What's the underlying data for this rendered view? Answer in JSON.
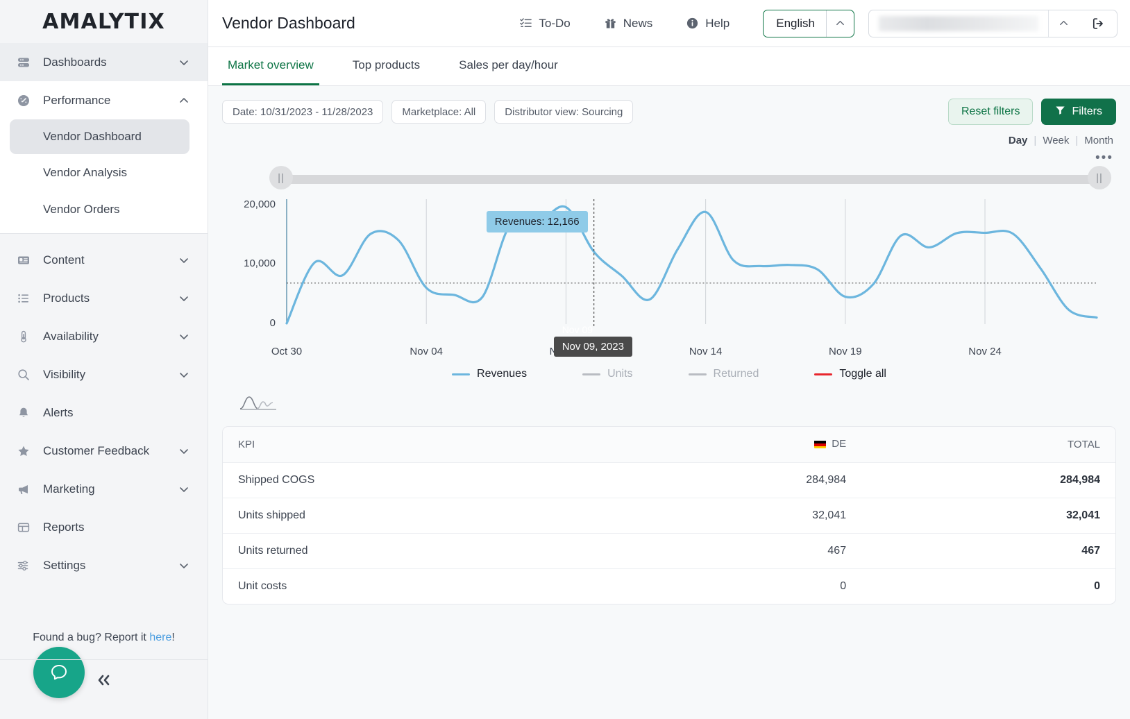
{
  "brand": {
    "logo": "AMALYTIX",
    "accent": "#0d7445",
    "accent_dark": "#11714a",
    "series_color": "#6cb6de"
  },
  "sidebar": {
    "groups": [
      {
        "label": "Dashboards",
        "icon": "dashboards-icon",
        "state": "collapsed"
      },
      {
        "label": "Performance",
        "icon": "performance-icon",
        "state": "expanded"
      }
    ],
    "performance_children": [
      {
        "label": "Vendor Dashboard",
        "active": true
      },
      {
        "label": "Vendor Analysis",
        "active": false
      },
      {
        "label": "Vendor Orders",
        "active": false
      }
    ],
    "lower_items": [
      {
        "label": "Content",
        "icon": "content-icon",
        "expandable": true
      },
      {
        "label": "Products",
        "icon": "products-icon",
        "expandable": true
      },
      {
        "label": "Availability",
        "icon": "availability-icon",
        "expandable": true
      },
      {
        "label": "Visibility",
        "icon": "visibility-icon",
        "expandable": true
      },
      {
        "label": "Alerts",
        "icon": "alerts-icon",
        "expandable": false
      },
      {
        "label": "Customer Feedback",
        "icon": "customer-feedback-icon",
        "expandable": true
      },
      {
        "label": "Marketing",
        "icon": "marketing-icon",
        "expandable": true
      },
      {
        "label": "Reports",
        "icon": "reports-icon",
        "expandable": false
      },
      {
        "label": "Settings",
        "icon": "settings-icon",
        "expandable": true
      }
    ],
    "bug_prefix": "Found a bug? Report it ",
    "bug_link": "here",
    "bug_suffix": "!",
    "collapse_glyph": "«"
  },
  "header": {
    "title": "Vendor Dashboard",
    "links": [
      {
        "label": "To-Do",
        "icon": "todo-icon"
      },
      {
        "label": "News",
        "icon": "gift-icon"
      },
      {
        "label": "Help",
        "icon": "info-icon"
      }
    ],
    "language": "English",
    "account_value": "",
    "logout_icon": "logout-icon"
  },
  "tabs": [
    {
      "label": "Market overview",
      "active": true
    },
    {
      "label": "Top products",
      "active": false
    },
    {
      "label": "Sales per day/hour",
      "active": false
    }
  ],
  "filters": {
    "chips": [
      "Date: 10/31/2023 - 11/28/2023",
      "Marketplace: All",
      "Distributor view: Sourcing"
    ],
    "reset_label": "Reset filters",
    "filters_label": "Filters"
  },
  "granularity": {
    "options": [
      "Day",
      "Week",
      "Month"
    ],
    "selected": "Day",
    "more_glyph": "•••"
  },
  "chart_data": {
    "type": "line",
    "title": "",
    "xlabel": "",
    "ylabel": "",
    "ylim": [
      0,
      21000
    ],
    "yticks": [
      0,
      10000,
      20000
    ],
    "ytick_labels": [
      "0",
      "10,000",
      "20,000"
    ],
    "grid": false,
    "xticks": [
      "Oct 30",
      "Nov 04",
      "Nov 09",
      "Nov 14",
      "Nov 19",
      "Nov 24"
    ],
    "xtick_indices": [
      0,
      5,
      10,
      15,
      20,
      25
    ],
    "average_line": 6900,
    "legend_position": "bottom",
    "series": [
      {
        "name": "Revenues",
        "color": "#6cb6de",
        "enabled": true,
        "x": [
          "Oct 30",
          "Oct 31",
          "Nov 01",
          "Nov 02",
          "Nov 03",
          "Nov 04",
          "Nov 05",
          "Nov 06",
          "Nov 07",
          "Nov 08",
          "Nov 09",
          "Nov 10",
          "Nov 11",
          "Nov 12",
          "Nov 13",
          "Nov 14",
          "Nov 15",
          "Nov 16",
          "Nov 17",
          "Nov 18",
          "Nov 19",
          "Nov 20",
          "Nov 21",
          "Nov 22",
          "Nov 23",
          "Nov 24",
          "Nov 25",
          "Nov 26",
          "Nov 27",
          "Nov 28"
        ],
        "values": [
          120,
          10350,
          8200,
          15150,
          14100,
          6100,
          4900,
          4500,
          16700,
          17000,
          19650,
          12166,
          8100,
          4150,
          12600,
          18850,
          10700,
          9750,
          9950,
          9200,
          4600,
          6700,
          14900,
          12900,
          15300,
          15350,
          15200,
          9300,
          2400,
          1100
        ]
      },
      {
        "name": "Units",
        "color": "#b9bcc2",
        "enabled": false,
        "values": []
      },
      {
        "name": "Returned",
        "color": "#b9bcc2",
        "enabled": false,
        "values": []
      }
    ],
    "toggle_all": {
      "label": "Toggle all",
      "color": "#e8262d"
    },
    "tooltip": {
      "value_text": "Revenues: 12,166",
      "date_text": "Nov 09, 2023",
      "axis_text": "Nov 09"
    }
  },
  "table": {
    "columns": [
      {
        "key": "kpi",
        "label": "KPI",
        "align": "left"
      },
      {
        "key": "de",
        "label": "DE",
        "align": "right",
        "flag": "de-flag-icon"
      },
      {
        "key": "total",
        "label": "TOTAL",
        "align": "right"
      }
    ],
    "rows": [
      {
        "kpi": "Shipped COGS",
        "de": "284,984",
        "total": "284,984"
      },
      {
        "kpi": "Units shipped",
        "de": "32,041",
        "total": "32,041"
      },
      {
        "kpi": "Units returned",
        "de": "467",
        "total": "467"
      },
      {
        "kpi": "Unit costs",
        "de": "0",
        "total": "0"
      }
    ]
  }
}
